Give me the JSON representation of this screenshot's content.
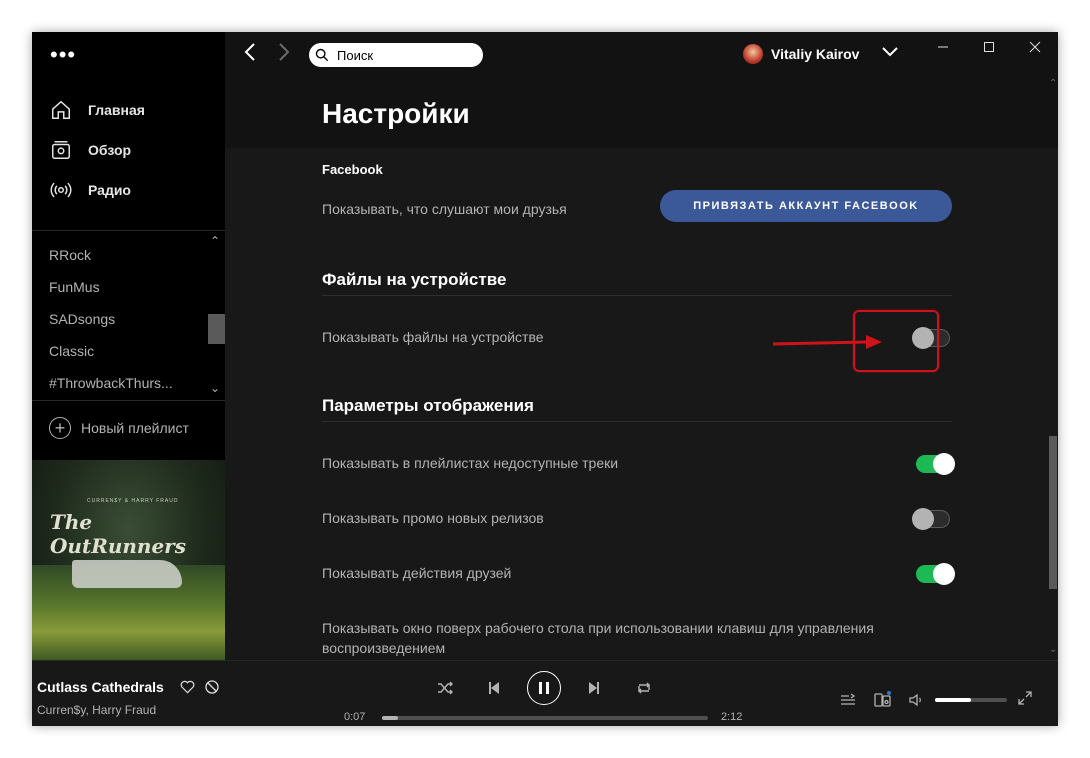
{
  "sidebar": {
    "nav": [
      {
        "label": "Главная",
        "icon": "home-icon"
      },
      {
        "label": "Обзор",
        "icon": "browse-icon"
      },
      {
        "label": "Радио",
        "icon": "radio-icon"
      }
    ],
    "playlists": [
      "RRock",
      "FunMus",
      "SADsongs",
      "Classic",
      "#ThrowbackThurs..."
    ],
    "new_playlist": "Новый плейлист",
    "album": {
      "artist_text": "CURREN$Y & HARRY FRAUD",
      "title_text": "The OutRunners"
    }
  },
  "topbar": {
    "search_placeholder": "Поиск",
    "user_name": "Vitaliy Kairov"
  },
  "settings": {
    "title": "Настройки",
    "facebook": {
      "heading": "Facebook",
      "row": "Показывать, что слушают мои друзья",
      "button": "ПРИВЯЗАТЬ АККАУНТ FACEBOOK"
    },
    "local_files": {
      "heading": "Файлы на устройстве",
      "row": "Показывать файлы на устройстве",
      "toggle": false
    },
    "display": {
      "heading": "Параметры отображения",
      "rows": [
        {
          "label": "Показывать в плейлистах недоступные треки",
          "toggle": true
        },
        {
          "label": "Показывать промо новых релизов",
          "toggle": false
        },
        {
          "label": "Показывать действия друзей",
          "toggle": true
        }
      ],
      "overlay_row": "Показывать окно поверх рабочего стола при использовании клавиш для управления воспроизведением"
    }
  },
  "player": {
    "track": "Cutlass Cathedrals",
    "artist": "Curren$y, Harry Fraud",
    "elapsed": "0:07",
    "duration": "2:12",
    "progress": 0.05,
    "volume": 0.5
  },
  "colors": {
    "accent_green": "#1db954",
    "facebook_blue": "#3b5998",
    "annotation_red": "#d0121b"
  }
}
